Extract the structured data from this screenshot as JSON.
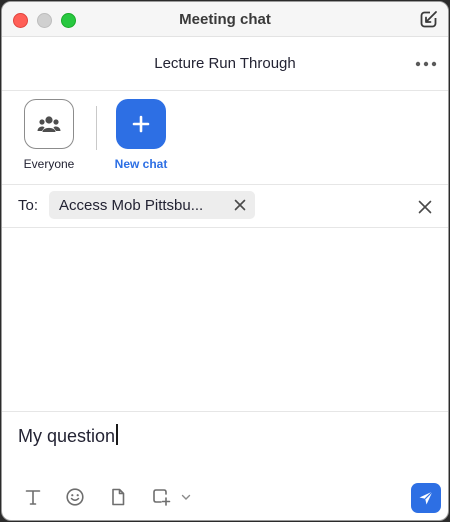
{
  "window": {
    "title": "Meeting chat",
    "icons": [
      "close-icon",
      "minimize-icon",
      "zoom-icon",
      "popout-icon"
    ]
  },
  "meeting": {
    "name": "Lecture Run Through",
    "more_icon": "more-horizontal-icon"
  },
  "chooser": {
    "items": [
      {
        "label": "Everyone",
        "icon": "group-icon"
      },
      {
        "label": "New chat",
        "icon": "plus-icon"
      }
    ]
  },
  "to_row": {
    "label": "To:",
    "recipient": "Access Mob Pittsbu..."
  },
  "compose": {
    "value": "My question",
    "tools": [
      "text-format-icon",
      "emoji-icon",
      "file-icon",
      "screenshot-icon",
      "chevron-down-icon"
    ],
    "send_icon": "send-icon"
  },
  "colors": {
    "accent": "#2d6fe4",
    "close": "#ff5f57",
    "maximize": "#28c840"
  }
}
